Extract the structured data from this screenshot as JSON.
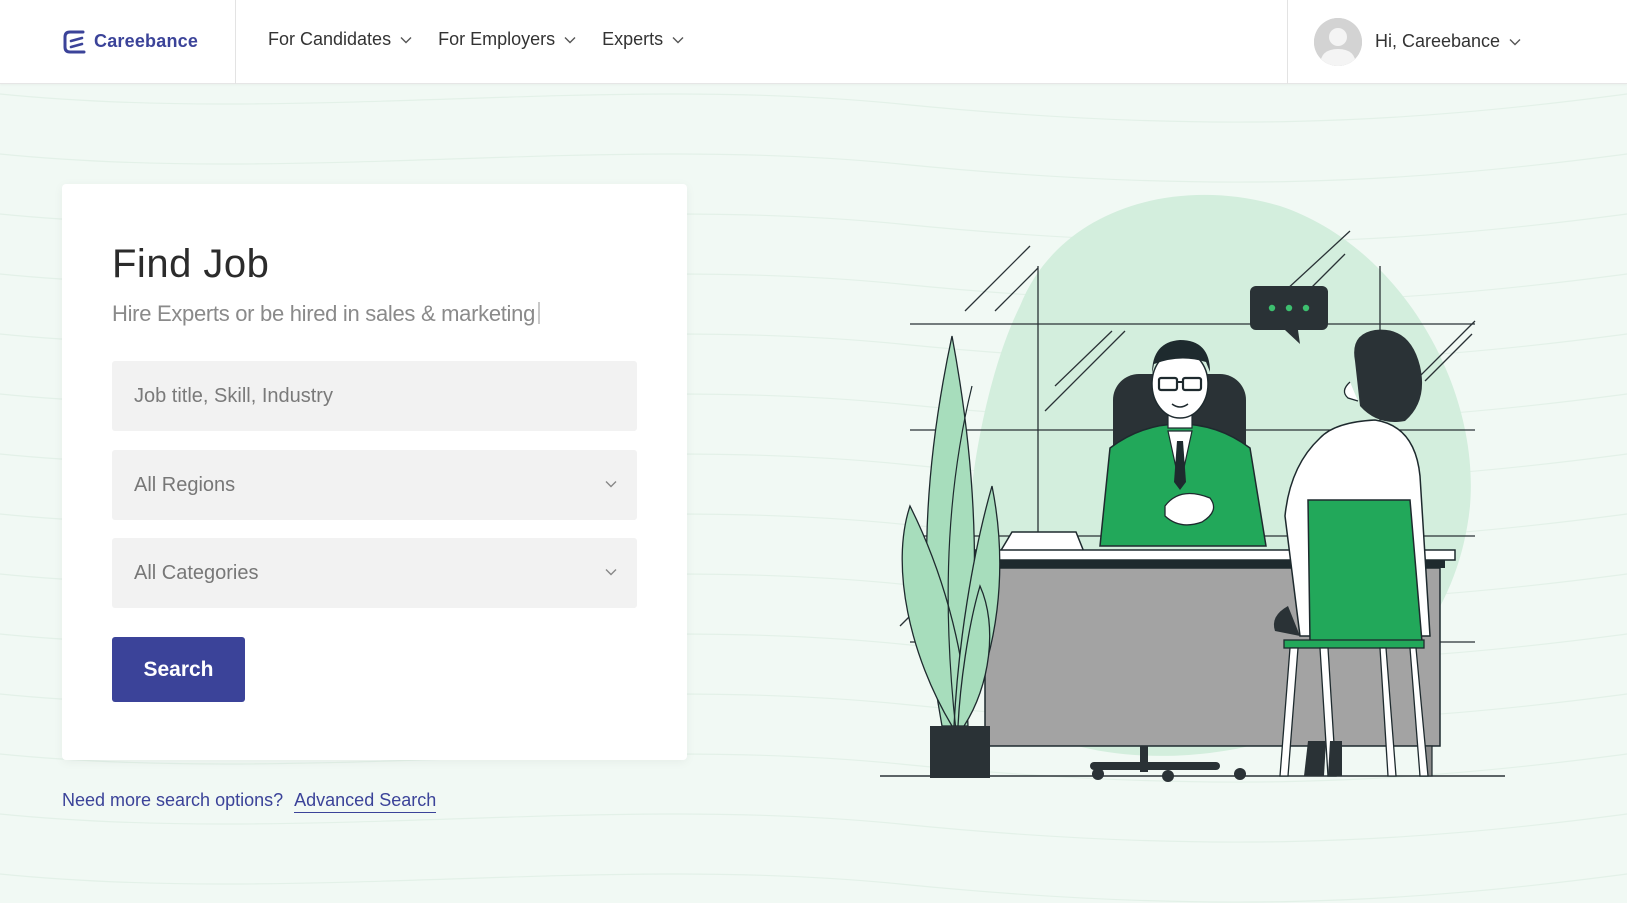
{
  "header": {
    "brand": "Careebance",
    "nav": [
      {
        "label": "For Candidates"
      },
      {
        "label": "For Employers"
      },
      {
        "label": "Experts"
      }
    ],
    "user_greeting": "Hi, Careebance"
  },
  "search": {
    "title": "Find Job",
    "subtitle": "Hire Experts or be hired in sales & marketing",
    "keyword_placeholder": "Job title, Skill, Industry",
    "region_value": "All Regions",
    "category_value": "All Categories",
    "button_label": "Search"
  },
  "footer_link": {
    "prompt": "Need more search options?",
    "link_label": "Advanced Search"
  },
  "colors": {
    "brand": "#3b4399",
    "accent_green": "#22a85a",
    "background": "#f1f9f4"
  }
}
